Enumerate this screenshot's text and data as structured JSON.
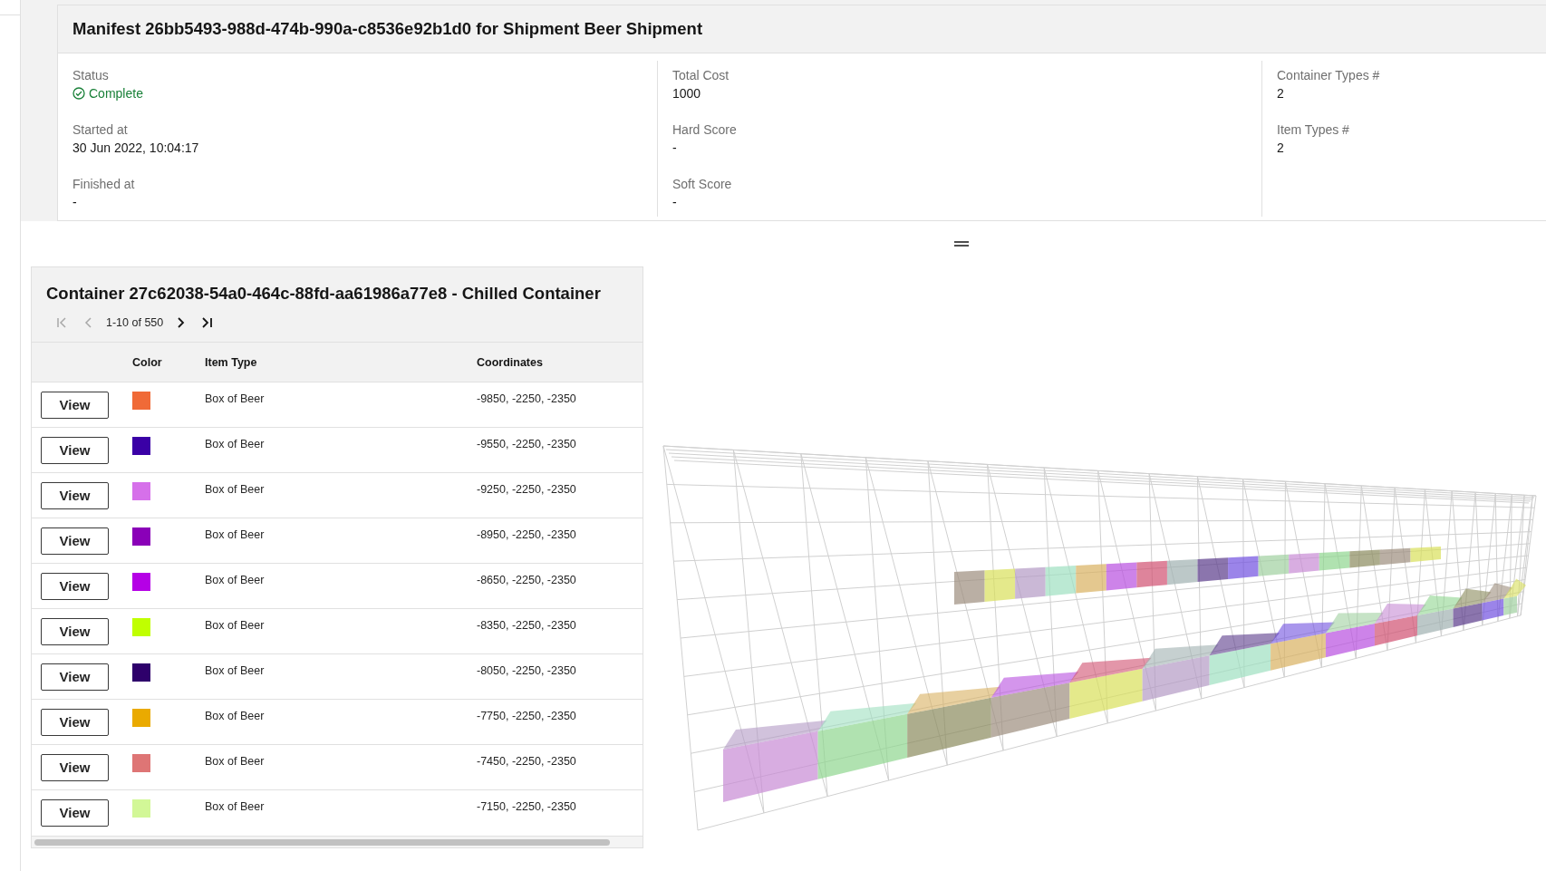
{
  "manifest": {
    "title": "Manifest 26bb5493-988d-474b-990a-c8536e92b1d0 for Shipment Beer Shipment",
    "columns": [
      [
        {
          "label": "Status",
          "value": "Complete",
          "kind": "status"
        },
        {
          "label": "Started at",
          "value": "30 Jun 2022, 10:04:17",
          "kind": "text"
        },
        {
          "label": "Finished at",
          "value": "-",
          "kind": "text"
        }
      ],
      [
        {
          "label": "Total Cost",
          "value": "1000",
          "kind": "text"
        },
        {
          "label": "Hard Score",
          "value": "-",
          "kind": "text"
        },
        {
          "label": "Soft Score",
          "value": "-",
          "kind": "text"
        }
      ],
      [
        {
          "label": "Container Types #",
          "value": "2",
          "kind": "text"
        },
        {
          "label": "Item Types #",
          "value": "2",
          "kind": "text"
        }
      ]
    ]
  },
  "container": {
    "title": "Container 27c62038-54a0-464c-88fd-aa61986a77e8 - Chilled Container",
    "pagination": {
      "range": "1-10 of 550",
      "buttons": [
        {
          "kind": "first",
          "disabled": true
        },
        {
          "kind": "prev",
          "disabled": true
        },
        {
          "kind": "next",
          "disabled": false
        },
        {
          "kind": "last",
          "disabled": false
        }
      ]
    },
    "table": {
      "columns": [
        "Color",
        "Item Type",
        "Coordinates"
      ],
      "rows": [
        {
          "button": "View",
          "color": "#f06a37",
          "item_type": "Box of Beer",
          "coordinates": "-9850, -2250, -2350"
        },
        {
          "button": "View",
          "color": "#3a00a6",
          "item_type": "Box of Beer",
          "coordinates": "-9550, -2250, -2350"
        },
        {
          "button": "View",
          "color": "#d670ea",
          "item_type": "Box of Beer",
          "coordinates": "-9250, -2250, -2350"
        },
        {
          "button": "View",
          "color": "#8a00b8",
          "item_type": "Box of Beer",
          "coordinates": "-8950, -2250, -2350"
        },
        {
          "button": "View",
          "color": "#b500e6",
          "item_type": "Box of Beer",
          "coordinates": "-8650, -2250, -2350"
        },
        {
          "button": "View",
          "color": "#c0ff00",
          "item_type": "Box of Beer",
          "coordinates": "-8350, -2250, -2350"
        },
        {
          "button": "View",
          "color": "#2e006b",
          "item_type": "Box of Beer",
          "coordinates": "-8050, -2250, -2350"
        },
        {
          "button": "View",
          "color": "#eaaa00",
          "item_type": "Box of Beer",
          "coordinates": "-7750, -2250, -2350"
        },
        {
          "button": "View",
          "color": "#de7575",
          "item_type": "Box of Beer",
          "coordinates": "-7450, -2250, -2350"
        },
        {
          "button": "View",
          "color": "#d2f797",
          "item_type": "Box of Beer",
          "coordinates": "-7150, -2250, -2350"
        }
      ]
    }
  }
}
